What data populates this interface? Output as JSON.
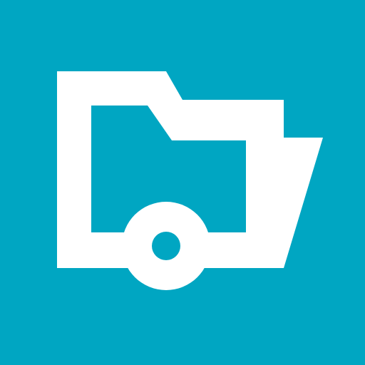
{
  "icon": {
    "semantic_name": "folder-disc-icon",
    "background_color": "#00A6C2",
    "foreground_color": "#FFFFFF"
  }
}
